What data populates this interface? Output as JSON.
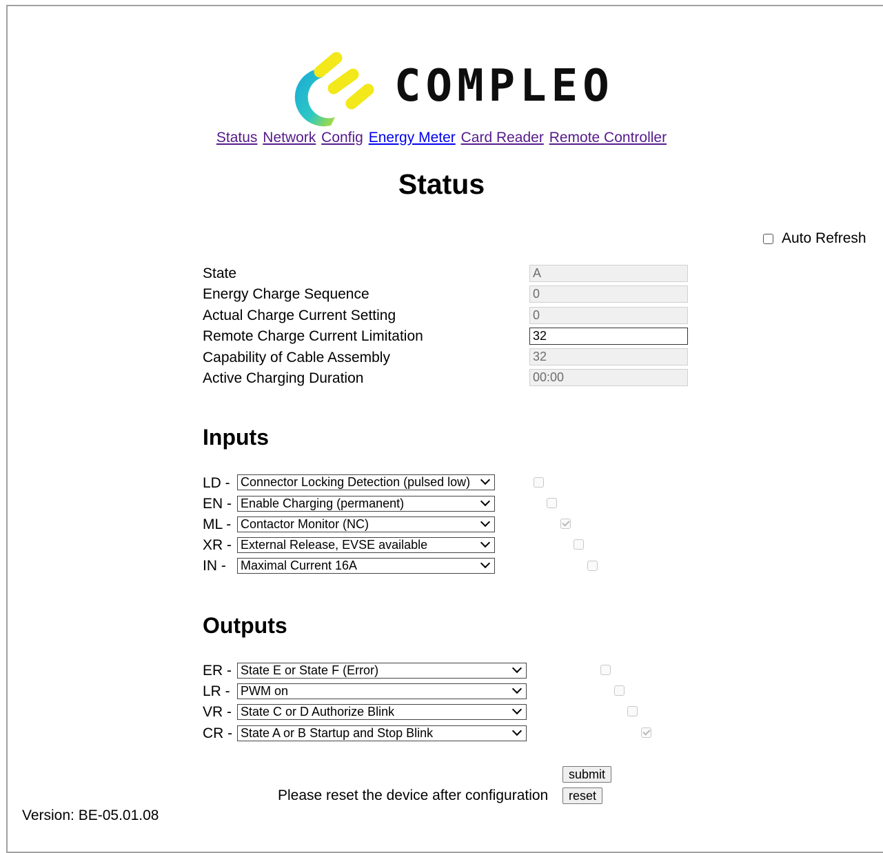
{
  "brand": {
    "name": "COMPLEO"
  },
  "nav": {
    "items": [
      "Status",
      "Network",
      "Config",
      "Energy Meter",
      "Card Reader",
      "Remote Controller"
    ]
  },
  "page_title": "Status",
  "auto_refresh": {
    "label": "Auto Refresh",
    "checked": false
  },
  "status": [
    {
      "label": "State",
      "value": "A"
    },
    {
      "label": "Energy Charge Sequence",
      "value": "0"
    },
    {
      "label": "Actual Charge Current Setting",
      "value": "0"
    },
    {
      "label": "Remote Charge Current Limitation",
      "value": "32"
    },
    {
      "label": "Capability of Cable Assembly",
      "value": "32"
    },
    {
      "label": "Active Charging Duration",
      "value": "00:00"
    }
  ],
  "inputs": {
    "title": "Inputs",
    "items": [
      {
        "prefix": "LD -",
        "selected": "Connector Locking Detection (pulsed low)",
        "checked": false
      },
      {
        "prefix": "EN -",
        "selected": "Enable Charging (permanent)",
        "checked": false
      },
      {
        "prefix": "ML -",
        "selected": "Contactor Monitor (NC)",
        "checked": true
      },
      {
        "prefix": "XR -",
        "selected": "External Release, EVSE available",
        "checked": false
      },
      {
        "prefix": "IN -",
        "selected": "Maximal Current 16A",
        "checked": false
      }
    ]
  },
  "outputs": {
    "title": "Outputs",
    "items": [
      {
        "prefix": "ER -",
        "selected": "State E or State F (Error)",
        "checked": false
      },
      {
        "prefix": "LR -",
        "selected": "PWM on",
        "checked": false
      },
      {
        "prefix": "VR -",
        "selected": "State C or D Authorize Blink",
        "checked": false
      },
      {
        "prefix": "CR -",
        "selected": "State A or B Startup and Stop Blink",
        "checked": true
      }
    ]
  },
  "actions": {
    "submit_label": "submit",
    "reset_message": "Please reset the device after configuration",
    "reset_label": "reset"
  },
  "version": "Version: BE-05.01.08"
}
